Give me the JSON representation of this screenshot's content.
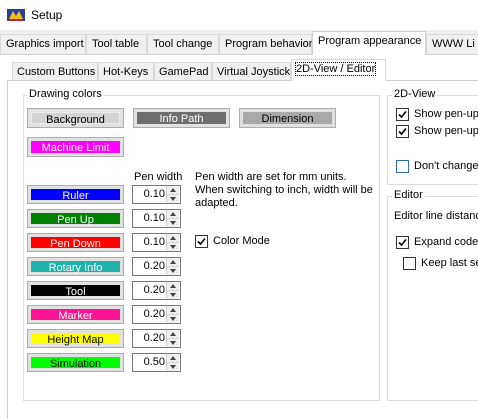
{
  "window": {
    "title": "Setup"
  },
  "main_tabs": [
    {
      "label": "Graphics import"
    },
    {
      "label": "Tool table"
    },
    {
      "label": "Tool change"
    },
    {
      "label": "Program behavior"
    },
    {
      "label": "Program appearance"
    },
    {
      "label": "WWW Li"
    }
  ],
  "inner_tabs": [
    {
      "label": "Custom Buttons"
    },
    {
      "label": "Hot-Keys"
    },
    {
      "label": "GamePad"
    },
    {
      "label": "Virtual Joystick"
    },
    {
      "label": "2D-View / Editor"
    }
  ],
  "drawing_colors": {
    "title": "Drawing colors",
    "pen_width_header": "Pen width",
    "note": [
      "Pen width are set for mm units.",
      "When switching to inch, width will be",
      "adapted."
    ],
    "color_mode_label": "Color Mode",
    "color_mode_checked": true,
    "background": {
      "label": "Background",
      "color": "#d4d4d4"
    },
    "info_path": {
      "label": "Info Path",
      "color": "#6e6e6e"
    },
    "dimension": {
      "label": "Dimension",
      "color": "#a9a9a9"
    },
    "machine_limit": {
      "label": "Machine Limit",
      "color": "#ff00ff"
    },
    "rows": [
      {
        "label": "Ruler",
        "color": "#0000ff",
        "text_color": "#ffffff",
        "width": "0.10"
      },
      {
        "label": "Pen Up",
        "color": "#008000",
        "text_color": "#ffffff",
        "width": "0.10"
      },
      {
        "label": "Pen Down",
        "color": "#ff0000",
        "text_color": "#ffffff",
        "width": "0.10"
      },
      {
        "label": "Rotary Info",
        "color": "#20b2aa",
        "text_color": "#ffffff",
        "width": "0.20"
      },
      {
        "label": "Tool",
        "color": "#000000",
        "text_color": "#ffffff",
        "width": "0.20"
      },
      {
        "label": "Marker",
        "color": "#ff1493",
        "text_color": "#ffffff",
        "width": "0.20"
      },
      {
        "label": "Height Map",
        "color": "#ffff00",
        "text_color": "#000000",
        "width": "0.20"
      },
      {
        "label": "Simulation",
        "color": "#00ff00",
        "text_color": "#000000",
        "width": "0.50"
      }
    ]
  },
  "view_2d": {
    "title": "2D-View",
    "options": [
      {
        "label": "Show pen-up",
        "checked": true
      },
      {
        "label": "Show pen-up",
        "checked": true
      },
      {
        "label": "Don't change",
        "checked": false
      }
    ]
  },
  "editor": {
    "title": "Editor",
    "line_distance_label": "Editor line distanc",
    "expand_label": "Expand code",
    "expand_checked": true,
    "keep_last_label": "Keep last se",
    "keep_last_checked": false
  }
}
